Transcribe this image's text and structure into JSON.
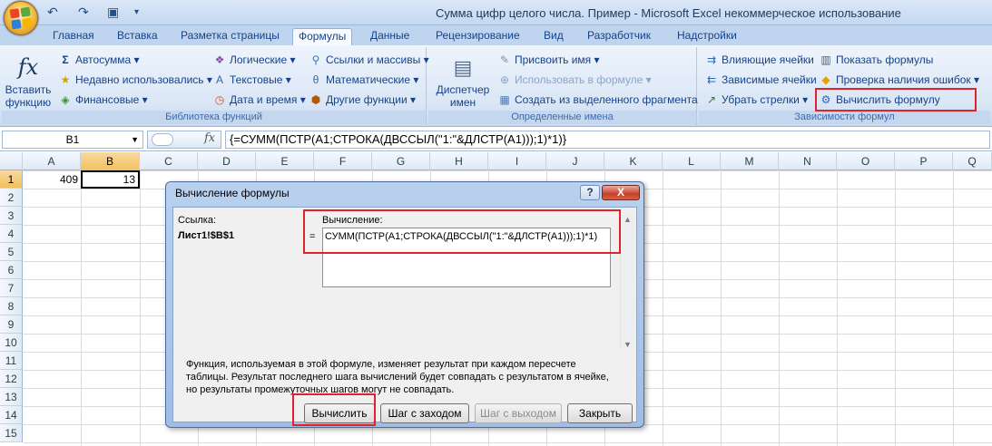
{
  "window": {
    "title": "Сумма цифр целого числа. Пример - Microsoft Excel некоммерческое использование"
  },
  "qat": {
    "undo": "↶",
    "redo": "↷",
    "save": "▣",
    "more": "▾"
  },
  "tabs": [
    "Главная",
    "Вставка",
    "Разметка страницы",
    "Формулы",
    "Данные",
    "Рецензирование",
    "Вид",
    "Разработчик",
    "Надстройки"
  ],
  "ribbon": {
    "func_library": {
      "insert_function": "Вставить функцию",
      "insert_icon": "fx",
      "autosum": "Автосумма",
      "recent": "Недавно использовались",
      "financial": "Финансовые",
      "logical": "Логические",
      "text": "Текстовые",
      "datetime": "Дата и время",
      "lookup": "Ссылки и массивы",
      "math": "Математические",
      "other": "Другие функции",
      "label": "Библиотека функций"
    },
    "defined_names": {
      "manager": "Диспетчер имен",
      "define": "Присвоить имя",
      "use": "Использовать в формуле",
      "create": "Создать из выделенного фрагмента",
      "label": "Определенные имена"
    },
    "auditing": {
      "precedents": "Влияющие ячейки",
      "dependents": "Зависимые ячейки",
      "remove_arrows": "Убрать стрелки",
      "show_formulas": "Показать формулы",
      "error_check": "Проверка наличия ошибок",
      "evaluate": "Вычислить формулу",
      "label": "Зависимости формул"
    }
  },
  "formula_bar": {
    "name_box": "B1",
    "formula": "{=СУММ(ПСТР(A1;СТРОКА(ДВССЫЛ(\"1:\"&ДЛСТР(A1)));1)*1)}"
  },
  "sheet": {
    "columns": [
      "A",
      "B",
      "C",
      "D",
      "E",
      "F",
      "G",
      "H",
      "I",
      "J",
      "K",
      "L",
      "M",
      "N",
      "O",
      "P",
      "Q"
    ],
    "rows": [
      "1",
      "2",
      "3",
      "4",
      "5",
      "6",
      "7",
      "8",
      "9",
      "10",
      "11",
      "12",
      "13",
      "14",
      "15"
    ],
    "a1": "409",
    "b1": "13"
  },
  "dialog": {
    "title": "Вычисление формулы",
    "help": "?",
    "close": "X",
    "ref_label": "Ссылка:",
    "ref_value": "Лист1!$B$1",
    "eq": "=",
    "eval_label": "Вычисление:",
    "eval_text": "СУММ(ПСТР(A1;СТРОКА(ДВССЫЛ(\"1:\"&ДЛСТР(A1)));1)*1)",
    "note": "Функция, используемая в этой формуле, изменяет результат при каждом пересчете таблицы. Результат последнего шага вычислений будет совпадать с результатом в ячейке, но результаты промежуточных шагов могут не совпадать.",
    "btn_evaluate": "Вычислить",
    "btn_step_in": "Шаг с заходом",
    "btn_step_out": "Шаг с выходом",
    "btn_close": "Закрыть"
  }
}
